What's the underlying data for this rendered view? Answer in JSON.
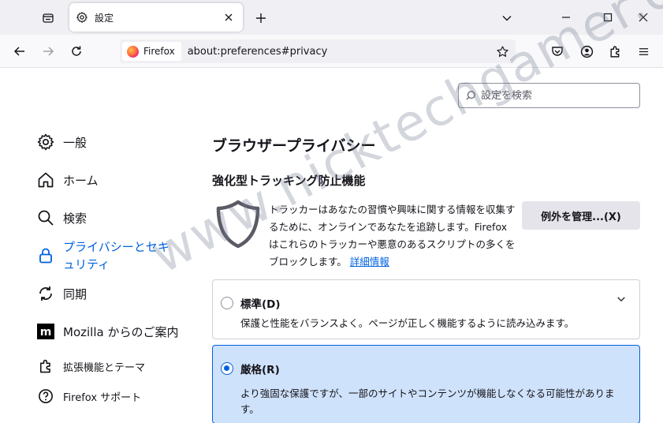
{
  "tab": {
    "title": "設定"
  },
  "navbar": {
    "identity_label": "Firefox",
    "url": "about:preferences#privacy"
  },
  "search": {
    "placeholder": "設定を検索"
  },
  "sidebar": {
    "items": [
      {
        "label": "一般",
        "icon": "gear-icon"
      },
      {
        "label": "ホーム",
        "icon": "home-icon"
      },
      {
        "label": "検索",
        "icon": "search-icon"
      },
      {
        "label": "プライバシーとセキュリティ",
        "icon": "lock-icon",
        "selected": true
      },
      {
        "label": "同期",
        "icon": "sync-icon"
      },
      {
        "label": "Mozilla からのご案内",
        "icon": "mozilla-icon"
      },
      {
        "label": "拡張機能とテーマ",
        "icon": "puzzle-icon"
      },
      {
        "label": "Firefox サポート",
        "icon": "help-icon"
      }
    ]
  },
  "main": {
    "heading": "ブラウザープライバシー",
    "section_title": "強化型トラッキング防止機能",
    "description": "トラッカーはあなたの習慣や興味に関する情報を収集するために、オンラインであなたを追跡します。Firefox はこれらのトラッカーや悪意のあるスクリプトの多くをブロックします。",
    "learn_more": "詳細情報",
    "manage_exceptions": "例外を管理...(X)",
    "options": [
      {
        "title": "標準(D)",
        "desc": "保護と性能をバランスよく。ページが正しく機能するように読み込みます。",
        "selected": false
      },
      {
        "title": "厳格(R)",
        "desc": "より強固な保護ですが、一部のサイトやコンテンツが機能しなくなる可能性があります。",
        "selected": true
      }
    ]
  },
  "watermark": "www.nicktechgamer.com",
  "colors": {
    "accent": "#0061e0",
    "selected_bg": "#cfe2fb",
    "tabstrip": "#f0f0f4"
  }
}
